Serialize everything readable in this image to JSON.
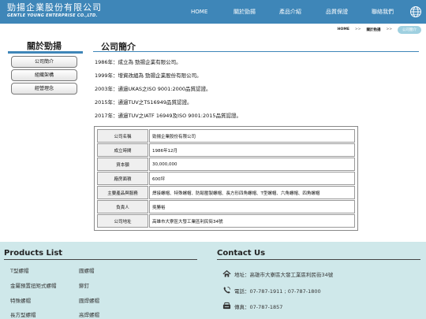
{
  "brand": {
    "name_cn": "勁揚企業股份有限公司",
    "name_en": "GENTLE YOUNG ENTERPRISE CO.,LTD."
  },
  "nav": [
    {
      "label": "HOME"
    },
    {
      "label": "關於勁揚"
    },
    {
      "label": "產品介紹"
    },
    {
      "label": "品質保證"
    },
    {
      "label": "聯絡我們"
    }
  ],
  "breadcrumb": {
    "home": "HOME",
    "sep": ">>",
    "middle": "關於勁揚",
    "current": "公司簡介"
  },
  "sidebar": {
    "title": "關於勁揚",
    "items": [
      {
        "label": "公司簡介"
      },
      {
        "label": "組織架構"
      },
      {
        "label": "經營理念"
      }
    ]
  },
  "main": {
    "title": "公司簡介",
    "history": [
      "1986年：成立為 勁揚企業有限公司。",
      "1999年：增資改組為 勁揚企業股份有限公司。",
      "2003年：通過UKAS之ISO 9001:2000品質認證。",
      "2015年：通過TUV之TS16949品質認證。",
      "2017年：通過TUV之IATF 16949及ISO 9001:2015品質認證。"
    ],
    "table": [
      {
        "key": "公司名稱",
        "value": "勁揚企業股份有限公司"
      },
      {
        "key": "成立時間",
        "value": "1986年12月"
      },
      {
        "key": "資本額",
        "value": "30,000,000"
      },
      {
        "key": "廠房面積",
        "value": "600坪"
      },
      {
        "key": "主要產品與服務",
        "value": "焊接螺帽、特殊螺帽、防鬆壓製螺帽、長方形四角螺帽、T型螺帽、六角螺帽、四角螺帽"
      },
      {
        "key": "負責人",
        "value": "吳勝裕"
      },
      {
        "key": "公司地址",
        "value": "高雄市大寮區大發工業區利民街34號"
      }
    ]
  },
  "footer": {
    "products_title": "Products List",
    "products": [
      "T型螺帽",
      "圓螺帽",
      "金屬預置扭矩式螺帽",
      "鉚釘",
      "特殊螺帽",
      "圓焊螺帽",
      "長方型螺帽",
      "高焊螺帽"
    ],
    "contact_title": "Contact Us",
    "address": "地址：高雄市大寮區大發工業區利民街34號",
    "phone": "電話：07-787-1911 ; 07-787-1800",
    "fax": "傳真：07-787-1857",
    "icons": {
      "address": "home-icon",
      "phone": "phone-icon",
      "fax": "fax-icon",
      "language": "globe-icon"
    }
  }
}
